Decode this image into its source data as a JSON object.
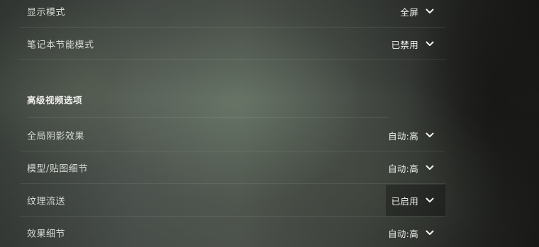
{
  "settings": {
    "display_mode": {
      "label": "显示模式",
      "value": "全屏"
    },
    "laptop_power_saving": {
      "label": "笔记本节能模式",
      "value": "已禁用"
    }
  },
  "advanced_video": {
    "title": "高级视频选项",
    "items": [
      {
        "label": "全局阴影效果",
        "value": "自动:高"
      },
      {
        "label": "模型/贴图细节",
        "value": "自动:高"
      },
      {
        "label": "纹理流送",
        "value": "已启用"
      },
      {
        "label": "效果细节",
        "value": "自动:高"
      }
    ]
  },
  "icons": {
    "dropdown": "chevron-down-icon"
  },
  "colors": {
    "text": "#d6d9d4",
    "value_text": "#f2f2f0",
    "divider": "rgba(255,255,255,0.09)"
  }
}
